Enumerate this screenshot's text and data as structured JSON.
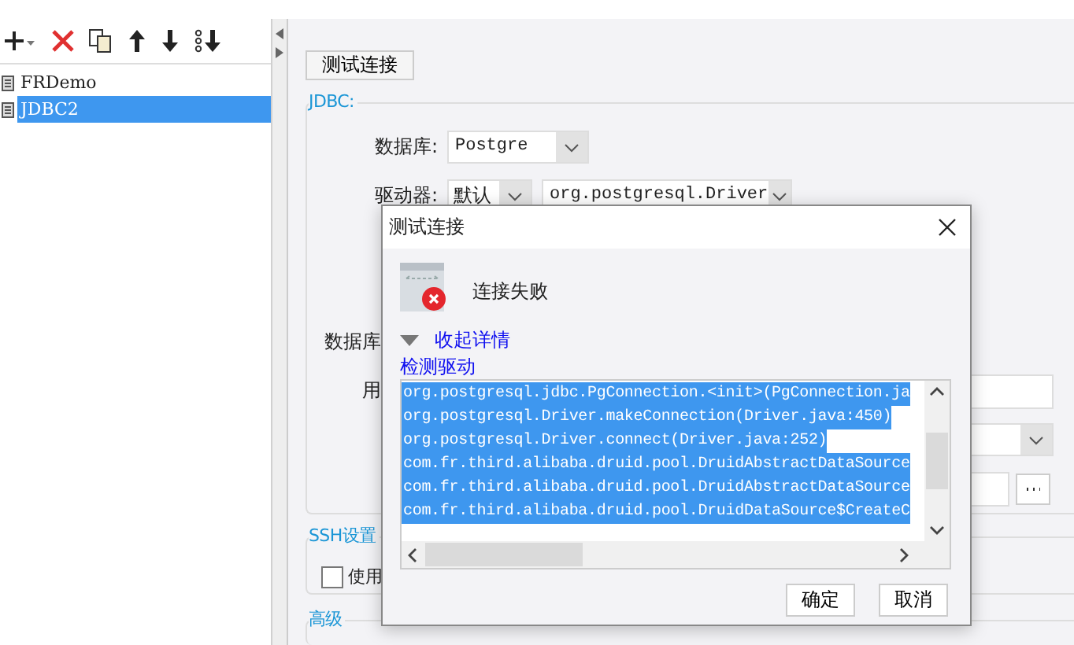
{
  "connections": [
    {
      "name": "FRDemo",
      "selected": false
    },
    {
      "name": "JDBC2",
      "selected": true
    }
  ],
  "test_button": "测试连接",
  "jdbc": {
    "legend": "JDBC:",
    "rows": [
      {
        "kind": "select",
        "label": "数据库:",
        "value": "Postgre"
      },
      {
        "kind": "driver",
        "label": "驱动器:",
        "mode": "默认",
        "value": "org.postgresql.Driver"
      },
      {
        "kind": "cut",
        "label": "数据库"
      },
      {
        "kind": "input",
        "label": "用"
      },
      {
        "kind": "dropdown"
      },
      {
        "kind": "file"
      }
    ]
  },
  "ssh": {
    "legend": "SSH设置",
    "checkbox": {
      "label": "使用",
      "checked": false
    }
  },
  "advanced": {
    "legend": "高级"
  },
  "dialog": {
    "title": "测试连接",
    "status": "连接失败",
    "details_toggle": {
      "label": "收起详情",
      "expanded": true
    },
    "section": "检测驱动",
    "trace": [
      {
        "text": "org.postgresql.jdbc.PgConnection.<init>(PgConnection.ja",
        "selected": true
      },
      {
        "text": "org.postgresql.Driver.makeConnection(Driver.java:450)",
        "selected": true
      },
      {
        "text": "org.postgresql.Driver.connect(Driver.java:252)",
        "selected": true
      },
      {
        "text": "com.fr.third.alibaba.druid.pool.DruidAbstractDataSource",
        "selected": true
      },
      {
        "text": "com.fr.third.alibaba.druid.pool.DruidAbstractDataSource",
        "selected": true
      },
      {
        "text": "com.fr.third.alibaba.druid.pool.DruidDataSource$CreateC",
        "selected": true
      }
    ],
    "buttons": [
      "确定",
      "取消"
    ]
  }
}
